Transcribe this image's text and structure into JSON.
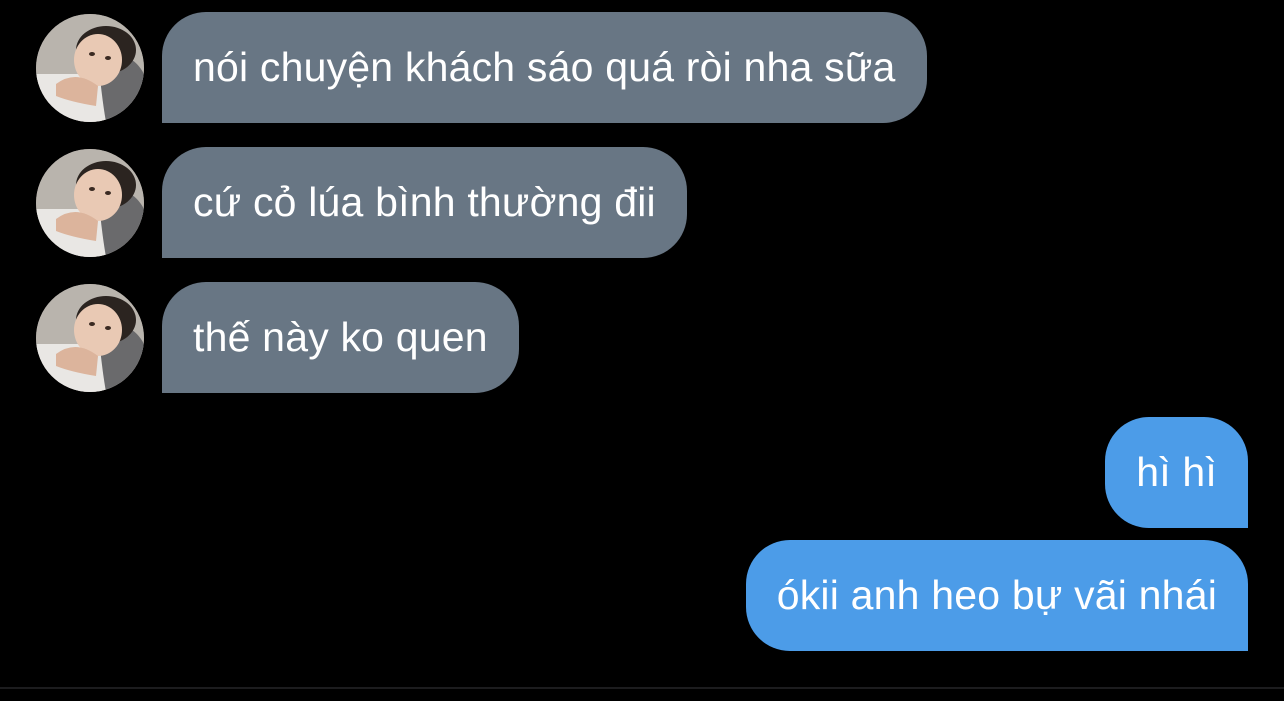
{
  "conversation": {
    "messages": [
      {
        "direction": "incoming",
        "text": "nói chuyện khách sáo quá ròi nha sữa",
        "has_avatar": true
      },
      {
        "direction": "incoming",
        "text": "cứ cỏ lúa bình thường đii",
        "has_avatar": true
      },
      {
        "direction": "incoming",
        "text": "thế này ko quen",
        "has_avatar": true
      },
      {
        "direction": "outgoing",
        "text": "hì hì",
        "has_avatar": false
      },
      {
        "direction": "outgoing",
        "text": "ókii anh heo bự vãi nhái",
        "has_avatar": false
      }
    ]
  },
  "colors": {
    "background": "#000000",
    "incoming_bubble": "#687684",
    "outgoing_bubble": "#4c9ce8",
    "text": "#ffffff"
  }
}
